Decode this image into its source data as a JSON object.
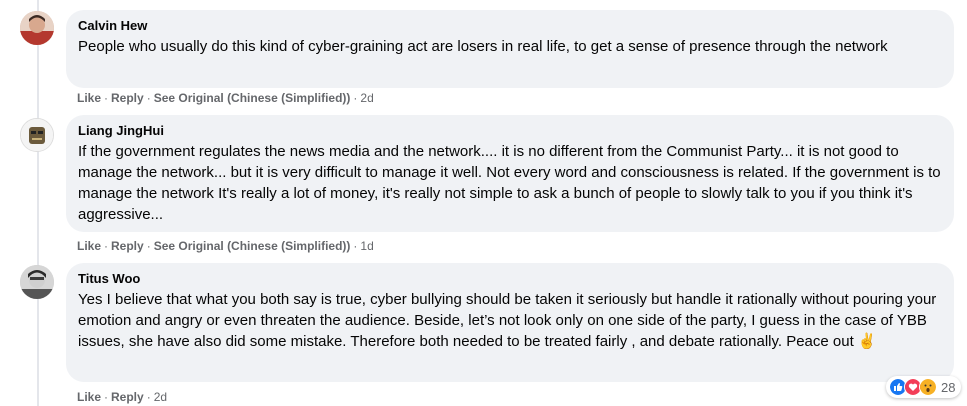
{
  "comments": [
    {
      "author": "Calvin Hew",
      "text": "People who usually do this kind of cyber-graining act are losers in real life, to get a sense of presence through the network",
      "actions": {
        "like": "Like",
        "reply": "Reply",
        "see_original": "See Original (Chinese (Simplified))",
        "time": "2d"
      }
    },
    {
      "author": "Liang JingHui",
      "text": "If the government regulates the news media and the network.... it is no different from the Communist Party... it is not good to manage the network... but it is very difficult to manage it well. Not every word and consciousness is related. If the government is to manage the network It's really a lot of money, it's really not simple to ask a bunch of people to slowly talk to you if you think it's aggressive...",
      "actions": {
        "like": "Like",
        "reply": "Reply",
        "see_original": "See Original (Chinese (Simplified))",
        "time": "1d"
      }
    },
    {
      "author": "Titus Woo",
      "text": "Yes I believe that what you both say is true, cyber bullying should be taken it seriously but handle it rationally without pouring your emotion and angry or even threaten the audience. Beside, let’s not look only on one side of the party, I guess in the case of YBB issues, she have also did some mistake. Therefore both needed to be treated fairly , and debate rationally. Peace out ✌️",
      "actions": {
        "like": "Like",
        "reply": "Reply",
        "time": "2d"
      },
      "reactions": {
        "icons": [
          "like-icon",
          "love-icon",
          "wow-icon"
        ],
        "count": "28",
        "colors": {
          "like": "#1877f2",
          "love": "#f33e58",
          "wow": "#f7b125"
        }
      }
    }
  ]
}
